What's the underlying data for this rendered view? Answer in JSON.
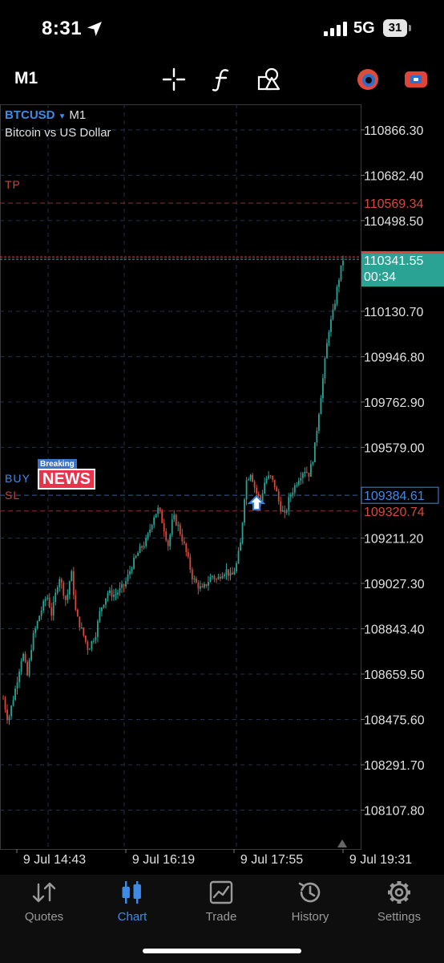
{
  "status": {
    "time": "8:31",
    "network": "5G",
    "battery": "31"
  },
  "toolbar": {
    "timeframe": "M1",
    "icons": [
      "crosshair-icon",
      "indicator-f-icon",
      "objects-icon",
      "account-icon",
      "trade-icon"
    ],
    "colors": {
      "accent": "#3d8be6",
      "account_icon": "#e24b3b",
      "trade_icon": "#e0443b"
    }
  },
  "chart": {
    "symbol": "BTCUSD",
    "symbol_tf": "M1",
    "description": "Bitcoin vs US Dollar",
    "levels": {
      "tp": "TP",
      "buy": "BUY",
      "sl": "SL"
    },
    "news_small": "Breaking",
    "news_big": "NEWS"
  },
  "chart_data": {
    "type": "candlestick",
    "symbol": "BTCUSD",
    "timeframe": "M1",
    "x_ticks": [
      "9 Jul 14:43",
      "9 Jul 16:19",
      "9 Jul 17:55",
      "9 Jul 19:31"
    ],
    "y_ticks": [
      "110866.30",
      "110682.40",
      "110498.50",
      "110130.70",
      "109946.80",
      "109762.90",
      "109579.00",
      "109211.20",
      "109027.30",
      "108843.40",
      "108659.50",
      "108475.60",
      "108291.70",
      "108107.80"
    ],
    "ylim": [
      107950,
      110970
    ],
    "price_tags": [
      {
        "label": "110569.34",
        "kind": "tp",
        "color": "#d8483c"
      },
      {
        "label": "110341.55",
        "time": "00:34",
        "kind": "bid",
        "color": "#2aa395"
      },
      {
        "label": "109384.61",
        "kind": "buy",
        "color": "#3d8be6"
      },
      {
        "label": "109320.74",
        "kind": "sl",
        "color": "#d8483c"
      }
    ],
    "price_path": [
      [
        0,
        108560
      ],
      [
        2,
        108470
      ],
      [
        5,
        108600
      ],
      [
        8,
        108750
      ],
      [
        10,
        108650
      ],
      [
        12,
        108800
      ],
      [
        15,
        108900
      ],
      [
        18,
        108980
      ],
      [
        20,
        108900
      ],
      [
        23,
        109060
      ],
      [
        26,
        108950
      ],
      [
        28,
        109080
      ],
      [
        30,
        108900
      ],
      [
        33,
        108820
      ],
      [
        35,
        108760
      ],
      [
        38,
        108820
      ],
      [
        40,
        108920
      ],
      [
        43,
        108990
      ],
      [
        46,
        108980
      ],
      [
        50,
        109020
      ],
      [
        53,
        109100
      ],
      [
        56,
        109160
      ],
      [
        59,
        109200
      ],
      [
        62,
        109300
      ],
      [
        64,
        109330
      ],
      [
        66,
        109260
      ],
      [
        68,
        109180
      ],
      [
        70,
        109300
      ],
      [
        72,
        109260
      ],
      [
        74,
        109200
      ],
      [
        76,
        109130
      ],
      [
        78,
        109050
      ],
      [
        80,
        109020
      ],
      [
        82,
        109000
      ],
      [
        84,
        109030
      ],
      [
        86,
        109060
      ],
      [
        88,
        109040
      ],
      [
        90,
        109070
      ],
      [
        92,
        109080
      ],
      [
        94,
        109050
      ],
      [
        96,
        109100
      ],
      [
        98,
        109200
      ],
      [
        99,
        109340
      ],
      [
        100,
        109440
      ],
      [
        102,
        109480
      ],
      [
        104,
        109400
      ],
      [
        106,
        109360
      ],
      [
        108,
        109450
      ],
      [
        110,
        109460
      ],
      [
        112,
        109420
      ],
      [
        114,
        109340
      ],
      [
        116,
        109300
      ],
      [
        118,
        109380
      ],
      [
        120,
        109420
      ],
      [
        122,
        109460
      ],
      [
        124,
        109490
      ],
      [
        126,
        109470
      ],
      [
        128,
        109550
      ],
      [
        130,
        109720
      ],
      [
        132,
        109880
      ],
      [
        134,
        110050
      ],
      [
        136,
        110130
      ],
      [
        138,
        110250
      ],
      [
        140,
        110341.55
      ]
    ]
  },
  "tabs": [
    {
      "label": "Quotes",
      "icon": "quotes-icon",
      "active": false
    },
    {
      "label": "Chart",
      "icon": "chart-icon",
      "active": true
    },
    {
      "label": "Trade",
      "icon": "trade-icon",
      "active": false
    },
    {
      "label": "History",
      "icon": "history-icon",
      "active": false
    },
    {
      "label": "Settings",
      "icon": "settings-icon",
      "active": false
    }
  ]
}
